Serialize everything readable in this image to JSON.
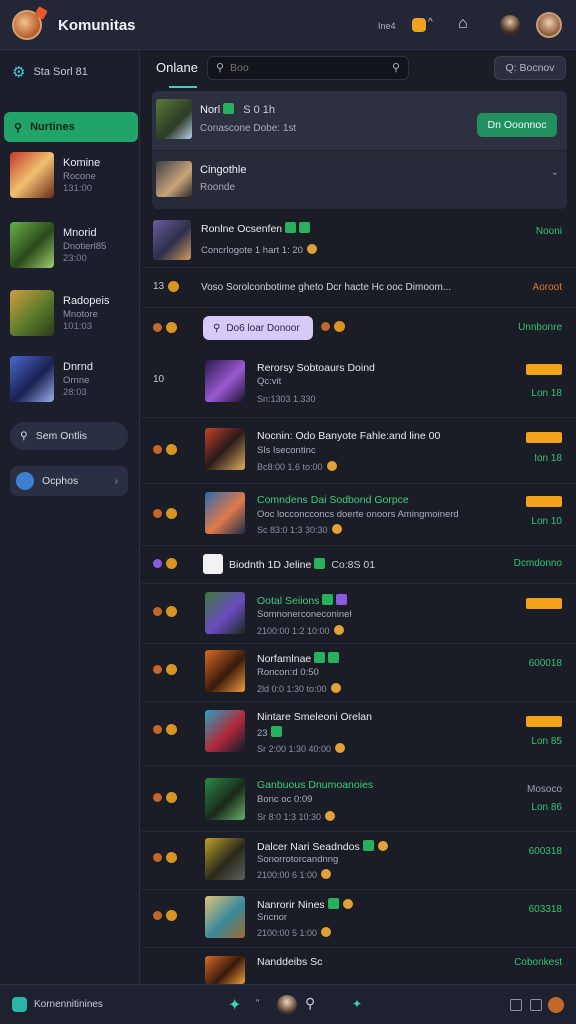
{
  "topbar": {
    "app_title": "Komunitas",
    "status_text": "Ine4",
    "chevron": "^"
  },
  "sidebar": {
    "header": "Sta Sorl 81",
    "search_label": "Nurtines",
    "items": [
      {
        "name": "Komine",
        "sub": "Rocone",
        "count": "131:00"
      },
      {
        "name": "Mnorid",
        "sub": "Dnotierl85",
        "count": "23:00"
      },
      {
        "name": "Radopeis",
        "sub": "Mnotore",
        "count": "101:03"
      },
      {
        "name": "Dnrnd",
        "sub": "Ornne",
        "count": "28:03"
      }
    ],
    "pill_label": "Sem Ontlis",
    "profile_label": "Ocphos"
  },
  "main": {
    "tab_label": "Onlane",
    "search_placeholder": "Boo",
    "filter_label": "Q: Bocnov"
  },
  "featured": {
    "title": "Norl",
    "title_extra": "S  0  1h",
    "sub": "Conascone Dobe: 1st",
    "join_label": "Dn Ooonnoc",
    "second_title": "Cingothle",
    "second_sub": "Roonde"
  },
  "rows": [
    {
      "title": "Ronlne Ocsenfen",
      "sub": "Concrlogote 1 hart 1: 20",
      "right": "Nooni"
    },
    {
      "lead": "13",
      "text": "Voso Sorolconbotime gheto Dcr hacte Hc ooc Dimoom...",
      "right": "Aoroot"
    },
    {
      "pill": "Do6 loar Donoor",
      "right": "Unnbonre"
    },
    {
      "lead": "10",
      "title": "Rerorsy Sobtoaurs Doind",
      "sub": "Qc:vit",
      "meta": "Sn:1303 1.330",
      "right": "Lon 18"
    },
    {
      "title": "Nocnin: Odo Banyote Fahle:and line 00",
      "sub": "Sls  Isecontinc",
      "meta": "Bc8:00 1.6 to:00",
      "right": "Ion 18"
    },
    {
      "title": "Comndens Dai Sodbond Gorpce",
      "sub": "Ooc locconcconcs doerte onoors Amingmoinerd",
      "meta": "Sc 83:0 1:3 30:30",
      "right": "Lon 10"
    },
    {
      "title": "Biodnth 1D Jeline",
      "title_extra": "Co:8S 01",
      "right": "Dcmdonno"
    },
    {
      "title": "Ootal Seiions",
      "sub": "Somnonerconeconinel",
      "meta": "2100:00 1:2 10:00",
      "right": ""
    },
    {
      "title": "Norfamlnae",
      "sub": "Roncon:d 0:50",
      "meta": "2ld 0:0 1:30 to:00",
      "right": "600018"
    },
    {
      "title": "Nintare Smeleoni Orelan",
      "sub": "23",
      "meta": "Sr 2:00 1:30 40:00",
      "right": "Lon 85"
    },
    {
      "title": "Ganbuous Dnumoanoies",
      "sub": "Bonc oc 0:09",
      "meta": "Sr 8:0 1:3 10:30",
      "right_top": "Mosoco",
      "right": "Lon 86"
    },
    {
      "title": "Dalcer Nari Seadndos",
      "sub": "Sonorrotorcandnng",
      "meta": "2100:00 6 1:00",
      "right": "600318"
    },
    {
      "title": "Nanrorir Nines",
      "sub": "Sncnor",
      "meta": "2100:00 5 1:00",
      "right": "603318"
    },
    {
      "title": "Nanddeibs Sc",
      "right": "Cobonkest"
    }
  ],
  "bottombar": {
    "label": "Kornennitinines",
    "mid": "“"
  },
  "colors": {
    "accent_green": "#22a36a",
    "accent_teal": "#3fd0c0",
    "tag_orange": "#f3a31a",
    "background": "#1a1c26"
  }
}
